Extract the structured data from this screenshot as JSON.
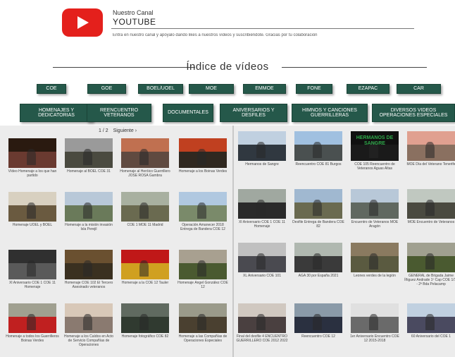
{
  "header": {
    "channel_small": "Nuestro Canal",
    "channel_big": "YOUTUBE",
    "description": "Entra en nuestro canal y apóyalo dando likes a nuestros vídeos y suscribiéndote. Gracias por tu colaboración"
  },
  "index_title": "Índice de vídeos",
  "category_row1": [
    "COE",
    "GOE",
    "BOEL/UOEL",
    "MOE",
    "EMMOE",
    "FONE",
    "EZAPAC",
    "CAR"
  ],
  "category_row2": [
    "HOMENAJES Y DEDICATORIAS",
    "REENCUENTRO VETERANOS",
    "DOCUMENTALES",
    "ANIVERSARIOS Y DESFILES",
    "HIMNOS Y CANCIONES GUERRILLERAS",
    "DIVERSOS VIDEOS OPERACIONES ESPECIALES"
  ],
  "pager": {
    "page": "1 / 2",
    "next": "Siguiente ›"
  },
  "left_videos": [
    {
      "caption": "Vídeo Homenaje a los que han partido",
      "top": "#2a1a10",
      "bottom": "#6a3a30"
    },
    {
      "caption": "Homenaje al BOEL COE 31",
      "top": "#9a9a9a",
      "bottom": "#4a4a40"
    },
    {
      "caption": "Homenaje al Heróico Guerrillero JOSE ROSA Gambra",
      "top": "#c07050",
      "bottom": "#604a40"
    },
    {
      "caption": "Homenaje a los Boinas Verdes",
      "top": "#c04020",
      "bottom": "#302820"
    },
    {
      "caption": "Homenaje UOEL y BOEL",
      "top": "#d8d0c0",
      "bottom": "#6a5a40"
    },
    {
      "caption": "Homenaje a la misión invasión Isla Perejil",
      "top": "#b8c8d8",
      "bottom": "#6a7a5a"
    },
    {
      "caption": "COE 1 MOE 11 Madrid",
      "top": "#a8b0a0",
      "bottom": "#6a6a50"
    },
    {
      "caption": "Operación Amanecer 2018 Entrega de Bandera COE 12",
      "top": "#b0c8e0",
      "bottom": "#7a8a6a"
    },
    {
      "caption": "XI Aniversario COE 1 COE 11 Homenaje",
      "top": "#303030",
      "bottom": "#5a5a5a"
    },
    {
      "caption": "Homenaje COE 102 El Tercero Asesinado veteranos",
      "top": "#6a5030",
      "bottom": "#3a3020"
    },
    {
      "caption": "Homenaje a la COE 12 Tauler",
      "top": "#c01818",
      "bottom": "#d0a020"
    },
    {
      "caption": "Homenaje Ángel González COE 12",
      "top": "#a8a090",
      "bottom": "#4a5a30"
    },
    {
      "caption": "Homenaje a todos los Guerrilleros Boinas Verdes",
      "top": "#a0a090",
      "bottom": "#c02020"
    },
    {
      "caption": "Homenaje a los Caídos en Acto de Servicio Compañías de Operaciones",
      "top": "#d8c8b8",
      "bottom": "#8a7a70"
    },
    {
      "caption": "Homenaje fotográfico COE 82",
      "top": "#606a60",
      "bottom": "#303a30"
    },
    {
      "caption": "Homenaje a las Compañías de Operaciones Especiales",
      "top": "#9a9a8a",
      "bottom": "#4a4030"
    }
  ],
  "right_videos": [
    {
      "caption": "Hermanos de Sangre",
      "top": "#c0d0e0",
      "bottom": "#303840"
    },
    {
      "caption": "Reencuentro COE 81 Burgos",
      "top": "#a0c0e0",
      "bottom": "#4a5050"
    },
    {
      "caption": "COE 105 Reencuentro de Veteranos Aguas Altas",
      "top": "#101010",
      "bottom": "#1a1a1a"
    },
    {
      "caption": "MOE Día del Veterano Tenerife",
      "top": "#e0a090",
      "bottom": "#8a7060"
    },
    {
      "caption": "XI Aniversario COE 1 COE 11 Homenaje",
      "top": "#a0a8a0",
      "bottom": "#2a2a2a"
    },
    {
      "caption": "Desfile Entrega de Bandera COE 82",
      "top": "#a0b8d0",
      "bottom": "#6a6a50"
    },
    {
      "caption": "Encuentro de Veteranos MOE Aragón",
      "top": "#b8c8d8",
      "bottom": "#606860"
    },
    {
      "caption": "MOE Encuentro de Veteranos",
      "top": "#c0c8c0",
      "bottom": "#4a4a40"
    },
    {
      "caption": "XL Aniversario COE 101",
      "top": "#c0c0c0",
      "bottom": "#4a4a50"
    },
    {
      "caption": "AGA 30 por España 2021",
      "top": "#b0b8b0",
      "bottom": "#3a3a3a"
    },
    {
      "caption": "Leones verdes de la legión",
      "top": "#8a7a60",
      "bottom": "#5a5a40"
    },
    {
      "caption": "GENERAL de Brigada Jaime Íñiguez Andrade 1º Cap COE 1/11 - 2ª Bda Pelacamp",
      "top": "#a0a090",
      "bottom": "#4a5a30"
    },
    {
      "caption": "Final del desfile 4 ENCUENTRO GUERRILLERO COE 2012 2022",
      "top": "#d0c8c0",
      "bottom": "#4a4040"
    },
    {
      "caption": "Reencuentro COE 12",
      "top": "#8a9aa8",
      "bottom": "#2a3040"
    },
    {
      "caption": "1er Aniversario Encuentro COE 12 2015-2018",
      "top": "#e0e0e0",
      "bottom": "#6a6a6a"
    },
    {
      "caption": "60 Aniversario del COE 1",
      "top": "#c0d0e0",
      "bottom": "#4a4a60"
    }
  ],
  "thumb_overlay": "HERMANOS DE SANGRE",
  "colors": {
    "button_green": "#25584a",
    "youtube_red": "#e4201c"
  }
}
